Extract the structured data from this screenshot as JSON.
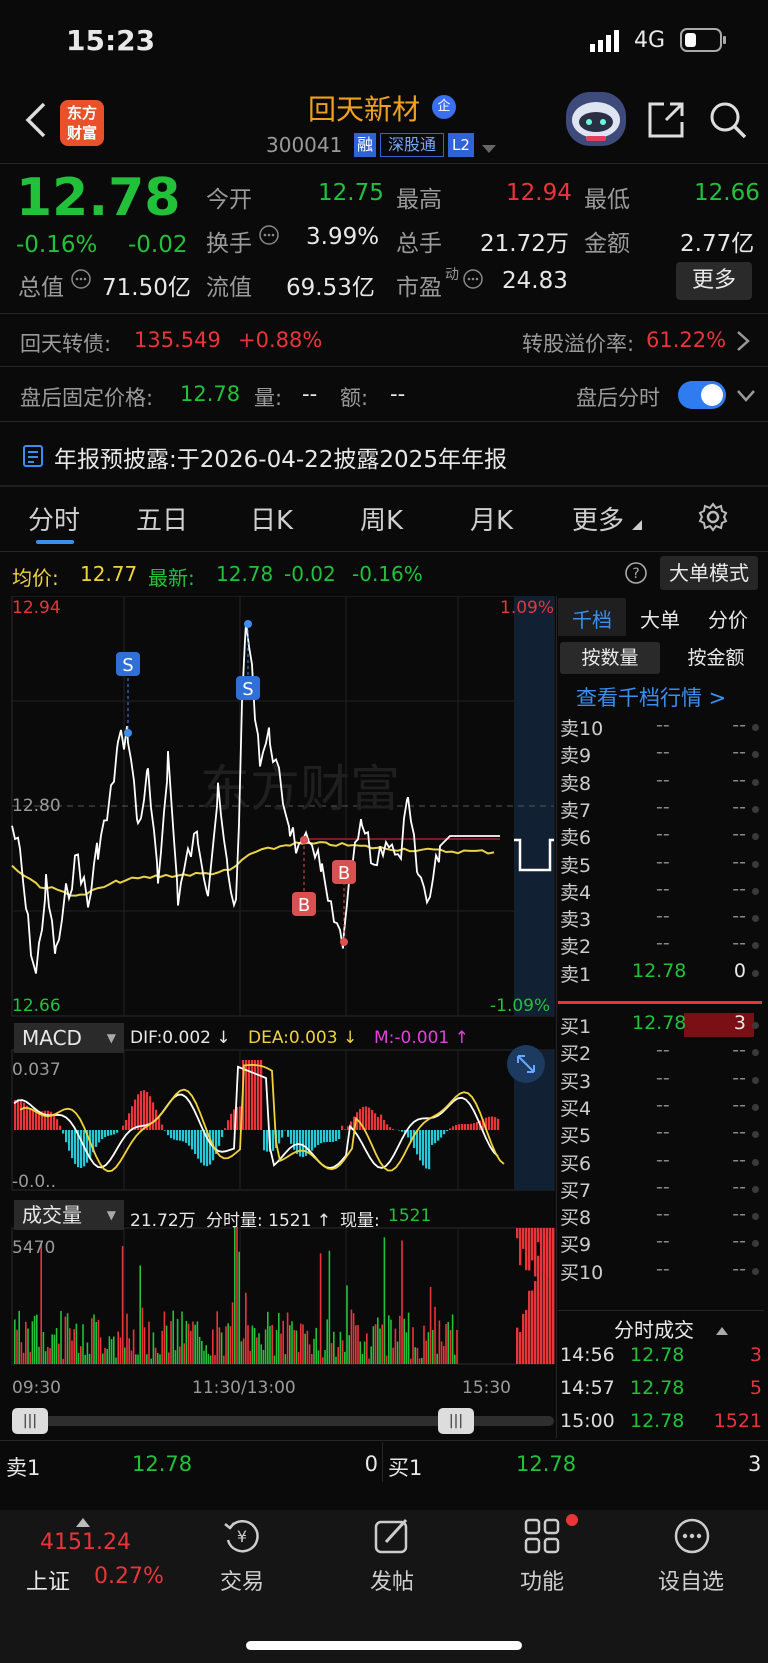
{
  "status": {
    "time": "15:23",
    "network": "4G"
  },
  "header": {
    "logo_line1": "东方",
    "logo_line2": "财富",
    "stock_name": "回天新材",
    "tag_qi": "企",
    "code": "300041",
    "tag_rong": "融",
    "tag_sgt": "深股通",
    "tag_l2": "L2"
  },
  "quote": {
    "price": "12.78",
    "pct": "-0.16%",
    "chg": "-0.02",
    "open_l": "今开",
    "open": "12.75",
    "high_l": "最高",
    "high": "12.94",
    "low_l": "最低",
    "low": "12.66",
    "turnover_l": "换手",
    "turnover": "3.99%",
    "vol_l": "总手",
    "vol": "21.72万",
    "amount_l": "金额",
    "amount": "2.77亿",
    "mcap_l": "总值",
    "mcap": "71.50亿",
    "fmcap_l": "流值",
    "fmcap": "69.53亿",
    "pe_l": "市盈",
    "pe_sup": "动",
    "pe": "24.83",
    "more": "更多"
  },
  "bond": {
    "name": "回天转债:",
    "price": "135.549",
    "pct": "+0.88%",
    "premium_l": "转股溢价率:",
    "premium": "61.22%"
  },
  "after": {
    "label": "盘后固定价格:",
    "price": "12.78",
    "vol_l": "量:",
    "vol": "--",
    "amt_l": "额:",
    "amt": "--",
    "switch_l": "盘后分时"
  },
  "notice": {
    "text": "年报预披露:于2026-04-22披露2025年年报"
  },
  "tabs": [
    "分时",
    "五日",
    "日K",
    "周K",
    "月K",
    "更多"
  ],
  "info": {
    "avg_l": "均价:",
    "avg": "12.77",
    "latest_l": "最新:",
    "latest": "12.78",
    "chg": "-0.02",
    "pct": "-0.16%",
    "bigorder": "大单模式"
  },
  "chart_axes": {
    "top": "12.94",
    "mid": "12.80",
    "bottom": "12.66",
    "top_pct": "1.09%",
    "bottom_pct": "-1.09%",
    "t0": "09:30",
    "t1": "11:30/13:00",
    "t2": "15:30",
    "watermark": "东方财富",
    "sig_s": "S",
    "sig_b": "B"
  },
  "macd": {
    "label": "MACD",
    "dif": "DIF:0.002 ↓",
    "dea": "DEA:0.003 ↓",
    "m": "M:-0.001 ↑",
    "top": "0.037",
    "bottom": "-0.0.."
  },
  "volume": {
    "label": "成交量",
    "total": "21.72万",
    "min_vol": "分时量: 1521 ↑",
    "cur_l": "现量:",
    "cur": "1521",
    "top": "5470"
  },
  "orderbook": {
    "tabs": [
      "千档",
      "大单",
      "分价"
    ],
    "sub": [
      "按数量",
      "按金额"
    ],
    "link": "查看千档行情 >",
    "sells": [
      [
        "卖10",
        "--",
        "--"
      ],
      [
        "卖9",
        "--",
        "--"
      ],
      [
        "卖8",
        "--",
        "--"
      ],
      [
        "卖7",
        "--",
        "--"
      ],
      [
        "卖6",
        "--",
        "--"
      ],
      [
        "卖5",
        "--",
        "--"
      ],
      [
        "卖4",
        "--",
        "--"
      ],
      [
        "卖3",
        "--",
        "--"
      ],
      [
        "卖2",
        "--",
        "--"
      ],
      [
        "卖1",
        "12.78",
        "0"
      ]
    ],
    "buys": [
      [
        "买1",
        "12.78",
        "3"
      ],
      [
        "买2",
        "--",
        "--"
      ],
      [
        "买3",
        "--",
        "--"
      ],
      [
        "买4",
        "--",
        "--"
      ],
      [
        "买5",
        "--",
        "--"
      ],
      [
        "买6",
        "--",
        "--"
      ],
      [
        "买7",
        "--",
        "--"
      ],
      [
        "买8",
        "--",
        "--"
      ],
      [
        "买9",
        "--",
        "--"
      ],
      [
        "买10",
        "--",
        "--"
      ]
    ],
    "trades_title": "分时成交",
    "trades": [
      [
        "14:56",
        "12.78",
        "3"
      ],
      [
        "14:57",
        "12.78",
        "5"
      ],
      [
        "15:00",
        "12.78",
        "1521"
      ]
    ]
  },
  "bottom_quote": {
    "sell_l": "卖1",
    "sell_p": "12.78",
    "sell_v": "0",
    "buy_l": "买1",
    "buy_p": "12.78",
    "buy_v": "3"
  },
  "nav": {
    "index_val": "4151.24",
    "index_name": "上证",
    "index_pct": "0.27%",
    "items": [
      "交易",
      "发帖",
      "功能",
      "设自选"
    ]
  },
  "colors": {
    "up": "#e9343a",
    "down": "#22c13a",
    "avg": "#f0d23a",
    "accent": "#3b8ef0"
  }
}
